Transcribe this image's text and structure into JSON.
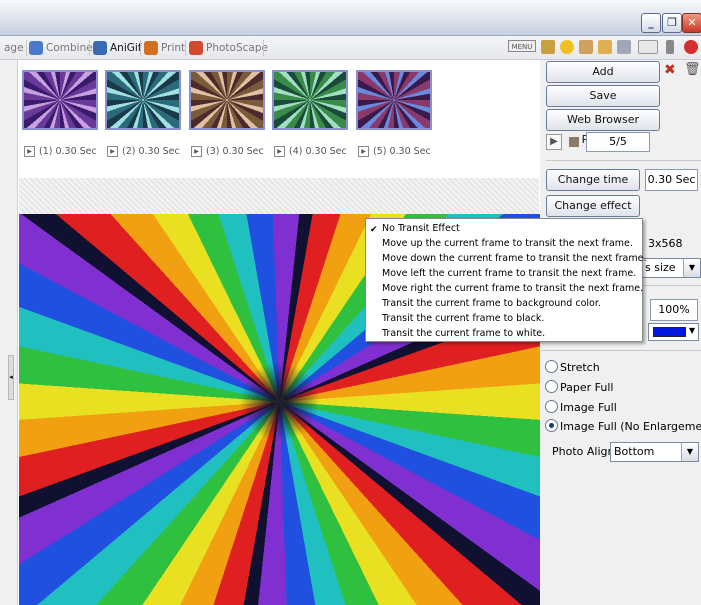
{
  "tabs": [
    {
      "label": "age",
      "active": false
    },
    {
      "label": "Combine",
      "active": false
    },
    {
      "label": "AniGif",
      "active": true
    },
    {
      "label": "Print",
      "active": false
    },
    {
      "label": "PhotoScape",
      "active": false
    }
  ],
  "toolbar_menu_label": "MENU",
  "frames": [
    {
      "label": "(1) 0.30 Sec"
    },
    {
      "label": "(2) 0.30 Sec"
    },
    {
      "label": "(3) 0.30 Sec"
    },
    {
      "label": "(4) 0.30 Sec"
    },
    {
      "label": "(5) 0.30 Sec"
    }
  ],
  "panel": {
    "add_label": "Add",
    "save_label": "Save",
    "preview_label": "Web Browser Preview",
    "frame_counter": "5/5",
    "change_time_label": "Change time",
    "time_value": "0.30 Sec",
    "change_effect_label": "Change effect",
    "size_fragment": "3x568",
    "size_option_fragment": "s size",
    "zoom_value": "100%",
    "fill_color": "#0018e0",
    "radios": [
      {
        "label": "Stretch",
        "checked": false
      },
      {
        "label": "Paper Full",
        "checked": false
      },
      {
        "label": "Image Full",
        "checked": false
      },
      {
        "label": "Image Full (No Enlargement)",
        "checked": true
      }
    ],
    "photo_align_label": "Photo Align",
    "photo_align_value": "Bottom"
  },
  "effect_menu": [
    {
      "label": "No Transit Effect",
      "checked": true
    },
    {
      "label": "Move up the current frame to transit the next frame.",
      "checked": false
    },
    {
      "label": "Move down the current frame to transit the next frame.",
      "checked": false
    },
    {
      "label": "Move left the current frame to transit the next frame.",
      "checked": false
    },
    {
      "label": "Move right the current frame to transit the next frame.",
      "checked": false
    },
    {
      "label": "Transit the current frame to background color.",
      "checked": false
    },
    {
      "label": "Transit the current frame to black.",
      "checked": false
    },
    {
      "label": "Transit the current frame to white.",
      "checked": false
    }
  ],
  "icons": {
    "minimize": "minimize-icon",
    "maximize": "maximize-icon",
    "close": "close-icon",
    "play": "play-icon",
    "stop": "stop-icon",
    "delete": "delete-x-icon",
    "trash": "trash-icon"
  }
}
